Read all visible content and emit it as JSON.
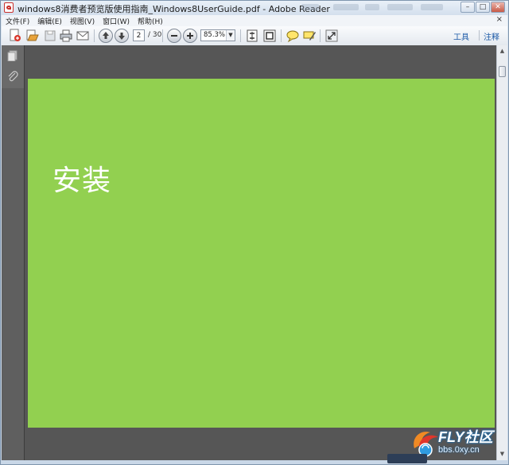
{
  "window": {
    "title": "windows8消费者预览版使用指南_Windows8UserGuide.pdf - Adobe Reader",
    "controls": {
      "minimize": "–",
      "maximize": "□",
      "close": "✕"
    }
  },
  "menubar": {
    "items": [
      "文件(F)",
      "编辑(E)",
      "视图(V)",
      "窗口(W)",
      "帮助(H)"
    ],
    "close_glyph": "×"
  },
  "toolbar": {
    "page_current": "2",
    "page_total": "/ 30",
    "zoom": "85.3%",
    "tools_label": "工具",
    "comment_label": "注释",
    "icons": [
      "create-pdf-icon",
      "open-icon",
      "save-icon",
      "print-icon",
      "email-icon",
      "page-up-icon",
      "page-down-icon",
      "zoom-out-icon",
      "zoom-in-icon",
      "fit-page-icon",
      "fit-width-icon",
      "comment-icon",
      "highlight-icon",
      "expand-icon"
    ]
  },
  "document": {
    "heading": "安装",
    "page_color": "#92d050"
  },
  "watermark": {
    "brand": "FLY社区",
    "url": "bbs.0xy.cn"
  }
}
